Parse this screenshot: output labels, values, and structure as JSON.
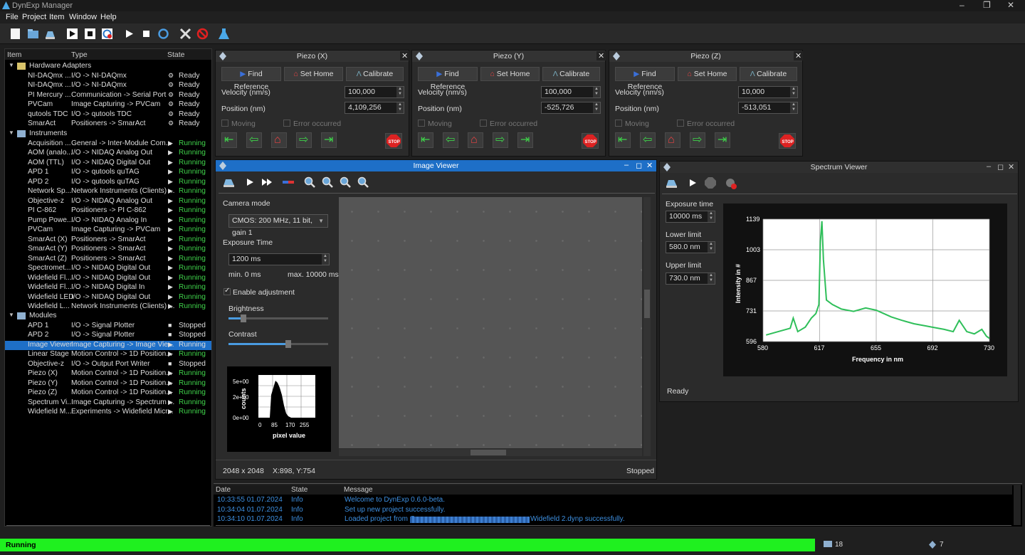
{
  "window": {
    "title": "DynExp Manager"
  },
  "menu": [
    "File",
    "Project",
    "Item",
    "Window",
    "Help"
  ],
  "tree": {
    "headers": {
      "item": "Item",
      "type": "Type",
      "state": "State"
    },
    "groups": [
      {
        "label": "Hardware Adapters",
        "y": 86,
        "rows": [
          {
            "item": "NI-DAQmx ...",
            "type": "I/O -> NI-DAQmx",
            "state": "Ready",
            "s": "ok"
          },
          {
            "item": "NI-DAQmx ...",
            "type": "I/O -> NI-DAQmx",
            "state": "Ready",
            "s": "ok"
          },
          {
            "item": "PI Mercury ...",
            "type": "Communication -> Serial Port",
            "state": "Ready",
            "s": "ok"
          },
          {
            "item": "PVCam",
            "type": "Image Capturing -> PVCam",
            "state": "Ready",
            "s": "ok"
          },
          {
            "item": "qutools TDC",
            "type": "I/O -> qutools TDC",
            "state": "Ready",
            "s": "ok"
          },
          {
            "item": "SmarAct",
            "type": "Positioners -> SmarAct",
            "state": "Ready",
            "s": "ok"
          }
        ]
      },
      {
        "label": "Instruments",
        "y": 181,
        "rows": [
          {
            "item": "Acquisition ...",
            "type": "General -> Inter-Module Com...",
            "state": "Running",
            "s": "run"
          },
          {
            "item": "AOM (analo...",
            "type": "I/O -> NIDAQ Analog Out",
            "state": "Running",
            "s": "run"
          },
          {
            "item": "AOM (TTL)",
            "type": "I/O -> NIDAQ Digital Out",
            "state": "Running",
            "s": "run"
          },
          {
            "item": "APD 1",
            "type": "I/O -> qutools quTAG",
            "state": "Running",
            "s": "run"
          },
          {
            "item": "APD 2",
            "type": "I/O -> qutools quTAG",
            "state": "Running",
            "s": "run"
          },
          {
            "item": "Network Sp...",
            "type": "Network Instruments (Clients) ...",
            "state": "Running",
            "s": "run"
          },
          {
            "item": "Objective-z",
            "type": "I/O -> NIDAQ Analog Out",
            "state": "Running",
            "s": "run"
          },
          {
            "item": "PI C-862",
            "type": "Positioners -> PI C-862",
            "state": "Running",
            "s": "run"
          },
          {
            "item": "Pump Powe...",
            "type": "I/O -> NIDAQ Analog In",
            "state": "Running",
            "s": "run"
          },
          {
            "item": "PVCam",
            "type": "Image Capturing -> PVCam",
            "state": "Running",
            "s": "run"
          },
          {
            "item": "SmarAct (X)",
            "type": "Positioners -> SmarAct",
            "state": "Running",
            "s": "run"
          },
          {
            "item": "SmarAct (Y)",
            "type": "Positioners -> SmarAct",
            "state": "Running",
            "s": "run"
          },
          {
            "item": "SmarAct (Z)",
            "type": "Positioners -> SmarAct",
            "state": "Running",
            "s": "run"
          },
          {
            "item": "Spectromet...",
            "type": "I/O -> NIDAQ Digital Out",
            "state": "Running",
            "s": "run"
          },
          {
            "item": "Widefield Fl...",
            "type": "I/O -> NIDAQ Digital Out",
            "state": "Running",
            "s": "run"
          },
          {
            "item": "Widefield Fl...",
            "type": "I/O -> NIDAQ Digital In",
            "state": "Running",
            "s": "run"
          },
          {
            "item": "Widefield LED",
            "type": "I/O -> NIDAQ Digital Out",
            "state": "Running",
            "s": "run"
          },
          {
            "item": "Widefield L...",
            "type": "Network Instruments (Clients) ...",
            "state": "Running",
            "s": "run"
          }
        ]
      },
      {
        "label": "Modules",
        "y": 437,
        "rows": [
          {
            "item": "APD 1",
            "type": "I/O -> Signal Plotter",
            "state": "Stopped",
            "s": "stop"
          },
          {
            "item": "APD 2",
            "type": "I/O -> Signal Plotter",
            "state": "Stopped",
            "s": "stop"
          },
          {
            "item": "Image Viewer",
            "type": "Image Capturing -> Image Vie...",
            "state": "Running",
            "s": "sel"
          },
          {
            "item": "Linear Stage",
            "type": "Motion Control -> 1D Position...",
            "state": "Running",
            "s": "run"
          },
          {
            "item": "Objective-z",
            "type": "I/O -> Output Port Writer",
            "state": "Stopped",
            "s": "stop"
          },
          {
            "item": "Piezo (X)",
            "type": "Motion Control -> 1D Position...",
            "state": "Running",
            "s": "run"
          },
          {
            "item": "Piezo (Y)",
            "type": "Motion Control -> 1D Position...",
            "state": "Running",
            "s": "run"
          },
          {
            "item": "Piezo (Z)",
            "type": "Motion Control -> 1D Position...",
            "state": "Running",
            "s": "run"
          },
          {
            "item": "Spectrum Vi...",
            "type": "Image Capturing -> Spectrum ...",
            "state": "Running",
            "s": "run"
          },
          {
            "item": "Widefield M...",
            "type": "Experiments -> Widefield Micr...",
            "state": "Running",
            "s": "run"
          }
        ]
      }
    ]
  },
  "piezo": {
    "labels": {
      "find": "Find Reference",
      "home": "Set Home",
      "cal": "Calibrate",
      "vel": "Velocity (nm/s)",
      "pos": "Position (nm)",
      "moving": "Moving",
      "error": "Error occurred",
      "stop": "STOP"
    },
    "panels": [
      {
        "title": "Piezo (X)",
        "velocity": "100,000",
        "position": "4,109,256"
      },
      {
        "title": "Piezo (Y)",
        "velocity": "100,000",
        "position": "-525,726"
      },
      {
        "title": "Piezo (Z)",
        "velocity": "10,000",
        "position": "-513,051"
      }
    ]
  },
  "imageviewer": {
    "title": "Image Viewer",
    "camera_mode_label": "Camera mode",
    "camera_mode": "CMOS: 200 MHz, 11 bit, gain 1",
    "exposure_label": "Exposure Time",
    "exposure": "1200 ms",
    "min": "min. 0 ms",
    "max": "max. 10000 ms",
    "enable": "Enable adjustment",
    "brightness": "Brightness",
    "contrast": "Contrast",
    "brightness_level": 0.15,
    "contrast_level": 0.6,
    "hist": {
      "y_ticks": [
        "5e+00",
        "2e+00",
        "0e+00"
      ],
      "x_ticks": [
        "0",
        "85",
        "170",
        "255"
      ],
      "ylabel": "counts",
      "xlabel": "pixel value"
    },
    "resolution": "2048 x 2048",
    "cursor": "X:898, Y:754",
    "state": "Stopped"
  },
  "spectrum": {
    "title": "Spectrum Viewer",
    "exposure_label": "Exposure time",
    "exposure": "10000 ms",
    "lower_label": "Lower limit",
    "lower": "580.0 nm",
    "upper_label": "Upper limit",
    "upper": "730.0 nm",
    "state": "Ready"
  },
  "chart_data": {
    "type": "line",
    "xlabel": "Frequency in nm",
    "ylabel": "Intensity in #",
    "xlim": [
      580,
      730
    ],
    "ylim": [
      596,
      1139
    ],
    "x_ticks": [
      "580",
      "617",
      "655",
      "692",
      "730"
    ],
    "y_ticks": [
      "1139",
      "1003",
      "867",
      "731",
      "596"
    ],
    "series": [
      {
        "color": "#2fbf5a",
        "x": [
          582,
          590,
          598,
          600,
          603,
          608,
          612,
          615,
          617,
          618,
          619,
          620,
          622,
          626,
          632,
          640,
          648,
          655,
          660,
          665,
          672,
          680,
          688,
          692,
          700,
          706,
          710,
          715,
          720,
          725,
          728,
          730
        ],
        "y": [
          625,
          640,
          655,
          700,
          640,
          660,
          700,
          720,
          760,
          1040,
          1130,
          960,
          780,
          760,
          740,
          730,
          745,
          735,
          720,
          705,
          690,
          675,
          665,
          660,
          650,
          640,
          690,
          640,
          630,
          650,
          620,
          610
        ]
      }
    ]
  },
  "log": {
    "headers": {
      "date": "Date",
      "state": "State",
      "message": "Message"
    },
    "rows": [
      {
        "date": "10:33:55 01.07.2024",
        "state": "Info",
        "message": "Welcome to DynExp 0.6.0-beta."
      },
      {
        "date": "10:34:04 01.07.2024",
        "state": "Info",
        "message": "Set up new project successfully."
      },
      {
        "date": "10:34:10 01.07.2024",
        "state": "Info",
        "message": "Loaded project from C:",
        "tail": "Widefield 2.dynp successfully."
      }
    ]
  },
  "statusbar": {
    "state": "Running",
    "hw_count": "18",
    "mod_count": "7"
  }
}
